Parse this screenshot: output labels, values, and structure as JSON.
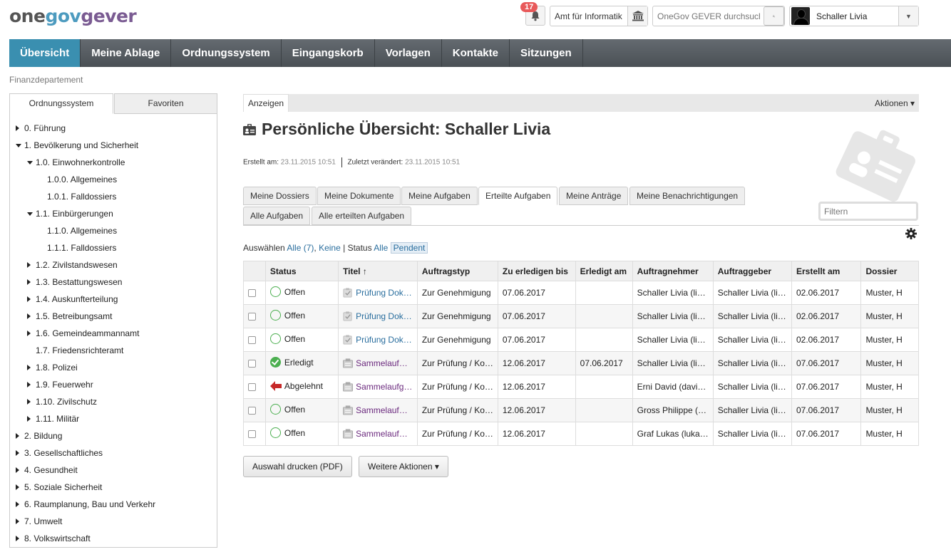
{
  "logo": {
    "one": "one",
    "gov": "gov",
    "gever": "gever"
  },
  "header": {
    "notifications_count": "17",
    "org_unit": "Amt für Informatik",
    "search_placeholder": "OneGov GEVER durchsuchen",
    "user_name": "Schaller Livia"
  },
  "nav": [
    "Übersicht",
    "Meine Ablage",
    "Ordnungssystem",
    "Eingangskorb",
    "Vorlagen",
    "Kontakte",
    "Sitzungen"
  ],
  "breadcrumb": "Finanzdepartement",
  "sidebar": {
    "tabs": [
      "Ordnungssystem",
      "Favoriten"
    ],
    "tree": [
      {
        "label": "0. Führung",
        "level": 0,
        "arrow": "right"
      },
      {
        "label": "1. Bevölkerung und Sicherheit",
        "level": 0,
        "arrow": "down"
      },
      {
        "label": "1.0. Einwohnerkontrolle",
        "level": 1,
        "arrow": "down"
      },
      {
        "label": "1.0.0. Allgemeines",
        "level": 2,
        "arrow": "none"
      },
      {
        "label": "1.0.1. Falldossiers",
        "level": 2,
        "arrow": "none"
      },
      {
        "label": "1.1. Einbürgerungen",
        "level": 1,
        "arrow": "down"
      },
      {
        "label": "1.1.0. Allgemeines",
        "level": 2,
        "arrow": "none"
      },
      {
        "label": "1.1.1. Falldossiers",
        "level": 2,
        "arrow": "none"
      },
      {
        "label": "1.2. Zivilstandswesen",
        "level": 1,
        "arrow": "right"
      },
      {
        "label": "1.3. Bestattungswesen",
        "level": 1,
        "arrow": "right"
      },
      {
        "label": "1.4. Auskunfterteilung",
        "level": 1,
        "arrow": "right"
      },
      {
        "label": "1.5. Betreibungsamt",
        "level": 1,
        "arrow": "right"
      },
      {
        "label": "1.6. Gemeindeammannamt",
        "level": 1,
        "arrow": "right"
      },
      {
        "label": "1.7. Friedensrichteramt",
        "level": 1,
        "arrow": "none"
      },
      {
        "label": "1.8. Polizei",
        "level": 1,
        "arrow": "right"
      },
      {
        "label": "1.9. Feuerwehr",
        "level": 1,
        "arrow": "right"
      },
      {
        "label": "1.10. Zivilschutz",
        "level": 1,
        "arrow": "right"
      },
      {
        "label": "1.11. Militär",
        "level": 1,
        "arrow": "right"
      },
      {
        "label": "2. Bildung",
        "level": 0,
        "arrow": "right"
      },
      {
        "label": "3. Gesellschaftliches",
        "level": 0,
        "arrow": "right"
      },
      {
        "label": "4. Gesundheit",
        "level": 0,
        "arrow": "right"
      },
      {
        "label": "5. Soziale Sicherheit",
        "level": 0,
        "arrow": "right"
      },
      {
        "label": "6. Raumplanung, Bau und Verkehr",
        "level": 0,
        "arrow": "right"
      },
      {
        "label": "7. Umwelt",
        "level": 0,
        "arrow": "right"
      },
      {
        "label": "8. Volkswirtschaft",
        "level": 0,
        "arrow": "right"
      }
    ]
  },
  "main": {
    "anzeigen": "Anzeigen",
    "aktionen": "Aktionen ▾",
    "title": "Persönliche Übersicht: Schaller Livia",
    "meta": {
      "created_label": "Erstellt am:",
      "created_value": "23.11.2015 10:51",
      "modified_label": "Zuletzt verändert:",
      "modified_value": "23.11.2015 10:51"
    },
    "filter_placeholder": "Filtern",
    "tabs_row1": [
      "Meine Dossiers",
      "Meine Dokumente",
      "Meine Aufgaben",
      "Erteilte Aufgaben",
      "Meine Anträge",
      "Meine Benachrichtigungen"
    ],
    "tabs_row2": [
      "Alle Aufgaben",
      "Alle erteilten Aufgaben"
    ],
    "active_tab": "Erteilte Aufgaben",
    "select_line": {
      "label": "Auswählen",
      "all": "Alle (7)",
      "none": "Keine",
      "status_label": "Status",
      "status_all": "Alle",
      "status_pending": "Pendent"
    },
    "columns": [
      "Status",
      "Titel ↑",
      "Auftragstyp",
      "Zu erledigen bis",
      "Erledigt am",
      "Auftragnehmer",
      "Auftraggeber",
      "Erstellt am",
      "Dossier"
    ],
    "rows": [
      {
        "status": "Offen",
        "status_icon": "open-circle",
        "title": "Prüfung Dok…",
        "title_color": "blue",
        "type": "Zur Genehmigung",
        "due": "07.06.2017",
        "done": "",
        "assignee": "Schaller Livia (li…",
        "issuer": "Schaller Livia (li…",
        "created": "02.06.2017",
        "dossier": "Muster, H"
      },
      {
        "status": "Offen",
        "status_icon": "open-circle",
        "title": "Prüfung Dok…",
        "title_color": "blue",
        "type": "Zur Genehmigung",
        "due": "07.06.2017",
        "done": "",
        "assignee": "Schaller Livia (li…",
        "issuer": "Schaller Livia (li…",
        "created": "02.06.2017",
        "dossier": "Muster, H"
      },
      {
        "status": "Offen",
        "status_icon": "open-circle",
        "title": "Prüfung Dok…",
        "title_color": "blue",
        "type": "Zur Genehmigung",
        "due": "07.06.2017",
        "done": "",
        "assignee": "Schaller Livia (li…",
        "issuer": "Schaller Livia (li…",
        "created": "02.06.2017",
        "dossier": "Muster, H"
      },
      {
        "status": "Erledigt",
        "status_icon": "done-check",
        "title": "Sammelauf…",
        "title_color": "purple",
        "type": "Zur Prüfung / Ko…",
        "due": "12.06.2017",
        "done": "07.06.2017",
        "assignee": "Schaller Livia (li…",
        "issuer": "Schaller Livia (li…",
        "created": "07.06.2017",
        "dossier": "Muster, H"
      },
      {
        "status": "Abgelehnt",
        "status_icon": "rejected-arrow",
        "title": "Sammelaufg…",
        "title_color": "purple",
        "type": "Zur Prüfung / Ko…",
        "due": "12.06.2017",
        "done": "",
        "assignee": "Erni David (davi…",
        "issuer": "Schaller Livia (li…",
        "created": "07.06.2017",
        "dossier": "Muster, H"
      },
      {
        "status": "Offen",
        "status_icon": "open-circle",
        "title": "Sammelauf…",
        "title_color": "purple",
        "type": "Zur Prüfung / Ko…",
        "due": "12.06.2017",
        "done": "",
        "assignee": "Gross Philippe (…",
        "issuer": "Schaller Livia (li…",
        "created": "07.06.2017",
        "dossier": "Muster, H"
      },
      {
        "status": "Offen",
        "status_icon": "open-circle",
        "title": "Sammelauf…",
        "title_color": "purple",
        "type": "Zur Prüfung / Ko…",
        "due": "12.06.2017",
        "done": "",
        "assignee": "Graf Lukas (luka…",
        "issuer": "Schaller Livia (li…",
        "created": "07.06.2017",
        "dossier": "Muster, H"
      }
    ],
    "buttons": {
      "print": "Auswahl drucken (PDF)",
      "more": "Weitere Aktionen ▾"
    }
  },
  "colors": {
    "nav_active": "#3a8fb0",
    "nav_bg": "#555b60",
    "link": "#2a6e9e",
    "purple_link": "#6b2a7e",
    "open_green": "#4caf50",
    "reject_red": "#c62828",
    "badge": "#e8595a"
  }
}
